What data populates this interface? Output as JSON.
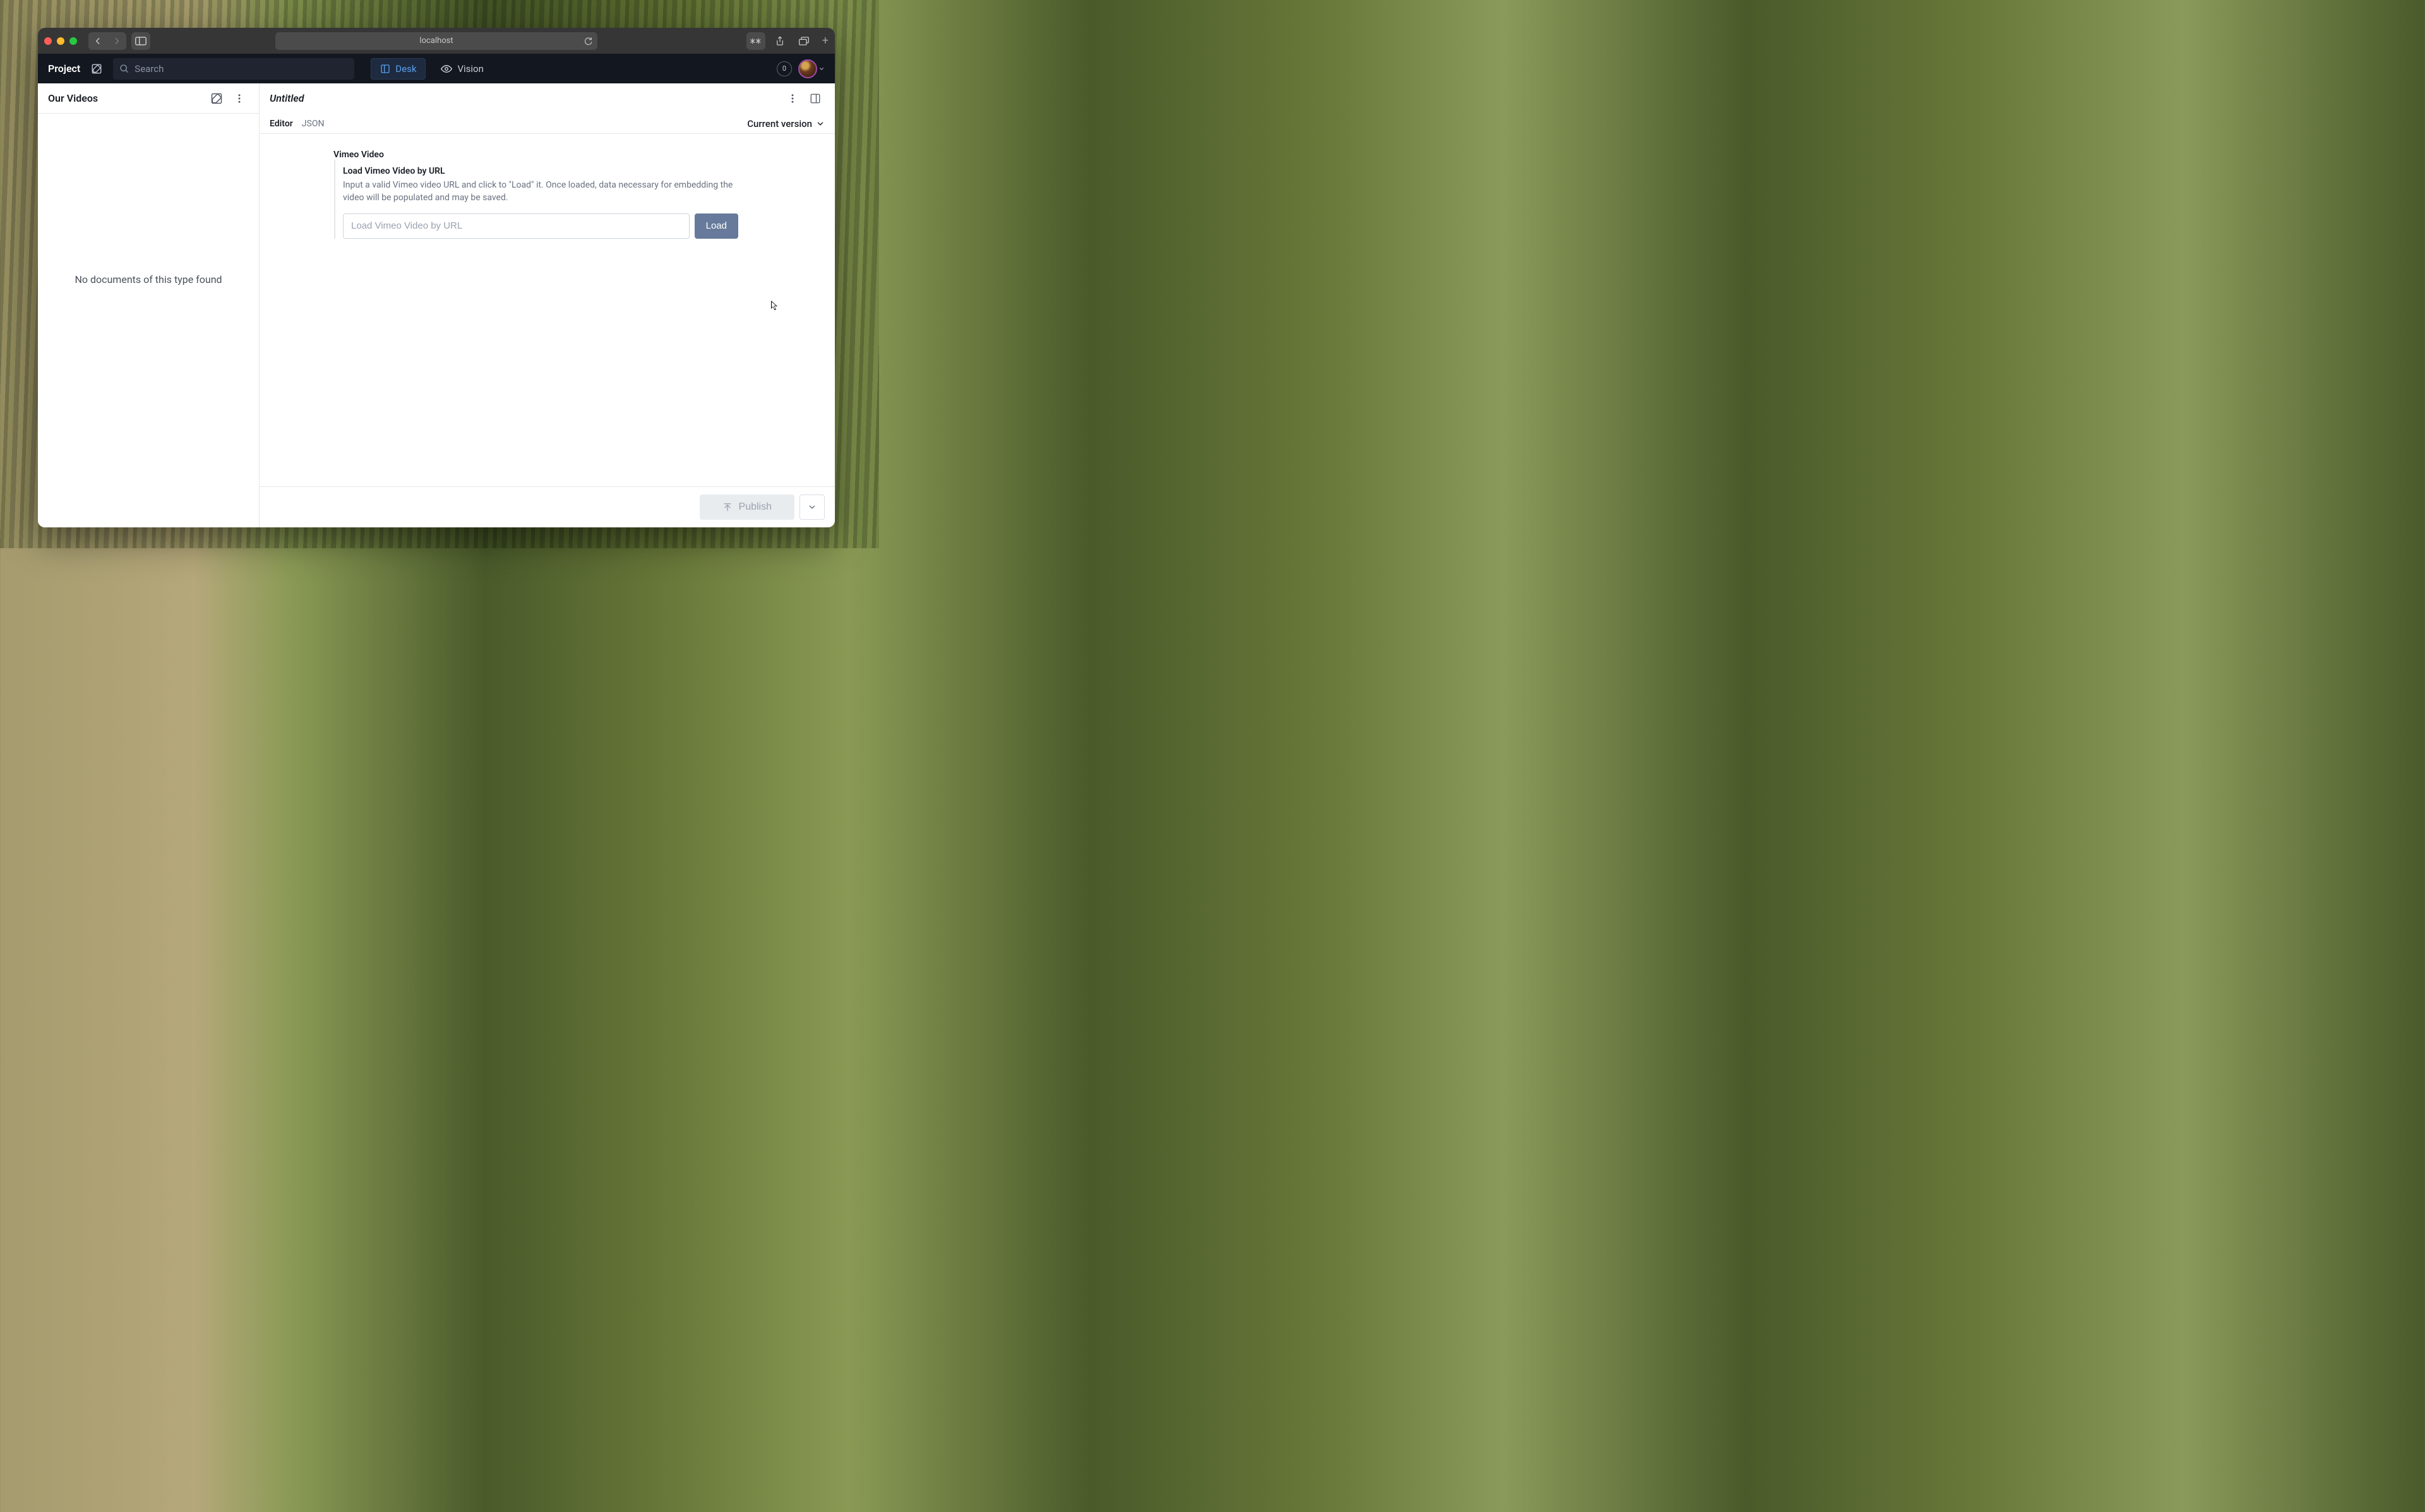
{
  "browser": {
    "url": "localhost"
  },
  "appbar": {
    "project": "Project",
    "search_placeholder": "Search",
    "tabs": {
      "desk": "Desk",
      "vision": "Vision"
    },
    "badge": "0"
  },
  "sidebar": {
    "title": "Our Videos",
    "empty_message": "No documents of this type found"
  },
  "document": {
    "title": "Untitled",
    "tabs": {
      "editor": "Editor",
      "json": "JSON"
    },
    "version_label": "Current version"
  },
  "field": {
    "section_title": "Vimeo Video",
    "label": "Load Vimeo Video by URL",
    "help": "Input a valid Vimeo video URL and click to \"Load\" it. Once loaded, data necessary for embedding the video will be populated and may be saved.",
    "placeholder": "Load Vimeo Video by URL",
    "button": "Load"
  },
  "publish": {
    "label": "Publish"
  }
}
